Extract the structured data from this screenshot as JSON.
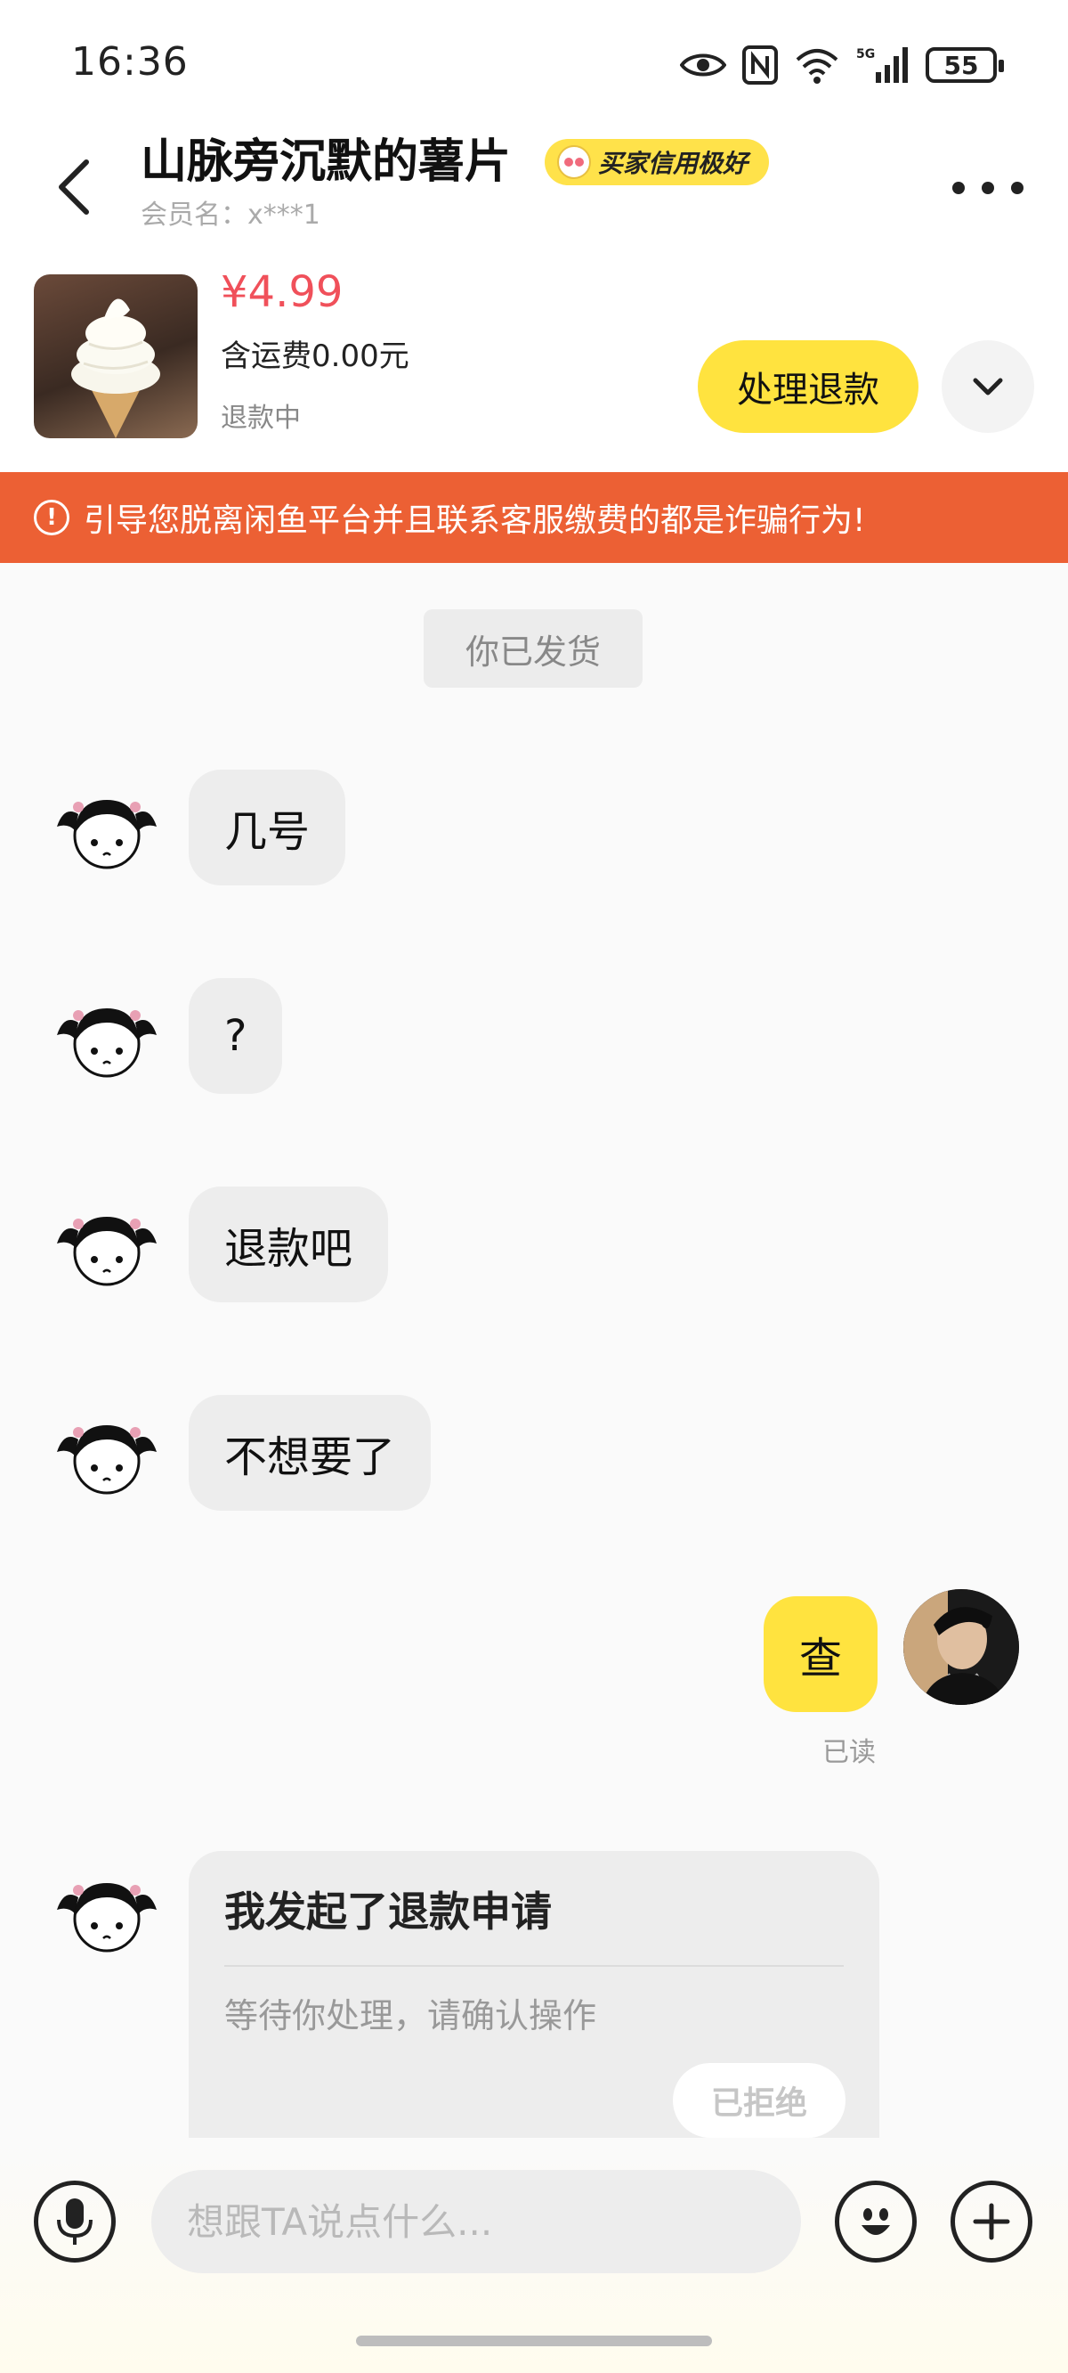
{
  "status_bar": {
    "time": "16:36",
    "network": "5G",
    "battery": "55"
  },
  "header": {
    "seller_name": "山脉旁沉默的薯片",
    "credit_badge": "买家信用极好",
    "member_label": "会员名：x***1"
  },
  "product": {
    "price": "¥4.99",
    "shipping": "含运费0.00元",
    "status": "退款中",
    "action_label": "处理退款"
  },
  "warning": {
    "icon": "!",
    "text": "引导您脱离闲鱼平台并且联系客服缴费的都是诈骗行为!"
  },
  "chat": {
    "system_message": "你已发货",
    "incoming": [
      {
        "text": "几号"
      },
      {
        "text": "?"
      },
      {
        "text": "退款吧"
      },
      {
        "text": "不想要了"
      }
    ],
    "outgoing": {
      "text": "查",
      "read_status": "已读"
    },
    "refund_card": {
      "title": "我发起了退款申请",
      "description": "等待你处理，请确认操作",
      "status_button": "已拒绝"
    }
  },
  "input": {
    "placeholder": "想跟TA说点什么..."
  },
  "colors": {
    "accent_yellow": "#ffe33f",
    "warning_orange": "#ec6034",
    "price_red": "#f0505a"
  }
}
